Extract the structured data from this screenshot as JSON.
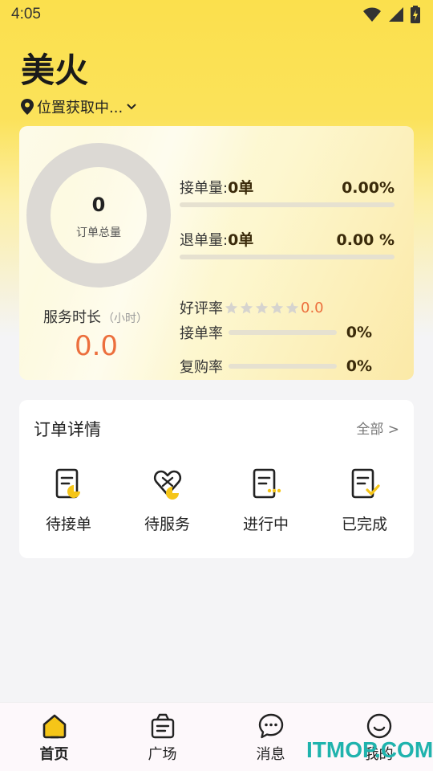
{
  "status_bar": {
    "time": "4:05"
  },
  "header": {
    "title": "美火",
    "location_text": "位置获取中..."
  },
  "stats": {
    "total_orders_value": "0",
    "total_orders_label": "订单总量",
    "service_hours_label": "服务时长",
    "service_hours_unit": "（小时）",
    "service_hours_value": "0.0",
    "accept_label": "接单量:",
    "accept_count": "0单",
    "accept_pct": "0.00%",
    "accept_fraction": 0,
    "refund_label": "退单量:",
    "refund_count": "0单",
    "refund_pct": "0.00 %",
    "refund_fraction": 0,
    "rating_label": "好评率",
    "rating_value": "0.0",
    "rating_stars_filled": 0,
    "rating_stars_total": 5,
    "accept_rate_label": "接单率",
    "accept_rate_pct": "0%",
    "accept_rate_fraction": 0,
    "repurchase_label": "复购率",
    "repurchase_pct": "0%",
    "repurchase_fraction": 0
  },
  "orders": {
    "title": "订单详情",
    "view_all": "全部 >",
    "items": [
      {
        "label": "待接单",
        "icon": "pending-order-icon"
      },
      {
        "label": "待服务",
        "icon": "pending-service-icon"
      },
      {
        "label": "进行中",
        "icon": "in-progress-icon"
      },
      {
        "label": "已完成",
        "icon": "completed-icon"
      }
    ]
  },
  "bottom_nav": {
    "items": [
      {
        "label": "首页",
        "icon": "home-icon",
        "active": true
      },
      {
        "label": "广场",
        "icon": "plaza-icon",
        "active": false
      },
      {
        "label": "消息",
        "icon": "message-icon",
        "active": false
      },
      {
        "label": "我的",
        "icon": "profile-icon",
        "active": false
      }
    ]
  },
  "watermark": "ITMOP.COM",
  "colors": {
    "accent_yellow": "#fbe04d",
    "icon_yellow": "#f5c518",
    "orange_value": "#ec6f3d",
    "ring_gray": "#dcd9d4"
  }
}
